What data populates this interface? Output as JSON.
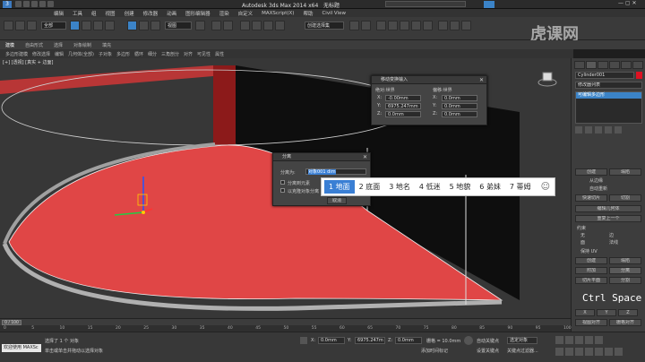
{
  "app": {
    "title": "Autodesk 3ds Max 2014 x64",
    "filename": "无标题"
  },
  "watermark": "虎课网",
  "menu": [
    "编辑",
    "工具",
    "组",
    "视图",
    "创建",
    "修改器",
    "动画",
    "图形编辑器",
    "渲染",
    "自定义",
    "MAXScript(X)",
    "帮助",
    "Civil View"
  ],
  "toolbar": {
    "selection_filter": "全部",
    "view_dropdown": "视图",
    "selection_set": "创建选择集"
  },
  "ribbon": {
    "tabs": [
      "建模",
      "自由形式",
      "选择",
      "对象绘制",
      "填充"
    ],
    "subtabs": [
      "多边形建模",
      "修改选择",
      "编辑",
      "几何体(全部)",
      "子对象",
      "多边形",
      "循环",
      "细分",
      "三角剖分",
      "对齐",
      "可见性",
      "属性"
    ]
  },
  "viewport": {
    "label": "[+] [透视] [真实 + 边面]",
    "floor_color": "#e04646"
  },
  "transform_dialog": {
    "title": "移动变换输入",
    "left_header": "绝对:世界",
    "right_header": "偏移:世界",
    "left_values": [
      "-0.00mm",
      "6975.247mm",
      "0.0mm"
    ],
    "right_values": [
      "0.0mm",
      "0.0mm",
      "0.0mm"
    ],
    "axes": [
      "X:",
      "Y:",
      "Z:"
    ]
  },
  "detach_dialog": {
    "title": "分离",
    "label": "分离为:",
    "input_value": "对象001 dim",
    "option1": "分离到元素",
    "option2": "以克隆对象分离",
    "ok": "确定",
    "cancel": "取消"
  },
  "ime": {
    "candidates": [
      "1 地面",
      "2 底面",
      "3 地名",
      "4 低迷",
      "5 地貌",
      "6 弟妹",
      "7 蒂姆"
    ],
    "emoji": "☺"
  },
  "right_panel": {
    "object_name": "Cylinder001",
    "modifier_list": "修改器列表",
    "stack_item": "可编辑多边形",
    "buttons": [
      "创建",
      "塌陷",
      "附加",
      "分离",
      "切片平面",
      "分割",
      "切片",
      "重置平面",
      "快速切片",
      "切割",
      "网格平滑",
      "细化",
      "平面化",
      "X",
      "Y",
      "Z",
      "视图对齐",
      "栅格对齐",
      "松弛",
      "隐藏选定对象",
      "全部取消隐藏",
      "隐藏未选定对象"
    ],
    "labels": [
      "从边缘",
      "自动重新",
      "编辑几何体",
      "重复上一个",
      "约束",
      "无",
      "边",
      "面",
      "法线",
      "保持 UV",
      "命名选择:",
      "复制",
      "粘贴",
      "删除孤立顶点",
      "完全交互"
    ],
    "keyboard_display": "Ctrl Space"
  },
  "timeline": {
    "frame": "0 / 100",
    "ticks": [
      "0",
      "5",
      "10",
      "15",
      "20",
      "25",
      "30",
      "35",
      "40",
      "45",
      "50",
      "55",
      "60",
      "65",
      "70",
      "75",
      "80",
      "85",
      "90",
      "95",
      "100"
    ]
  },
  "status": {
    "welcome": "欢迎使用 MAXSc",
    "selected": "选择了 1 个 对象",
    "prompt": "单击或单击并拖动以选择对象",
    "x": "0.0mm",
    "y": "6975.247m",
    "z": "0.0mm",
    "grid": "栅格 = 10.0mm",
    "add_time_tag": "添加时间标记",
    "auto_key": "自动关键点",
    "set_key": "设置关键点",
    "selected_obj": "选定对象",
    "key_filter": "关键点过滤器..."
  }
}
